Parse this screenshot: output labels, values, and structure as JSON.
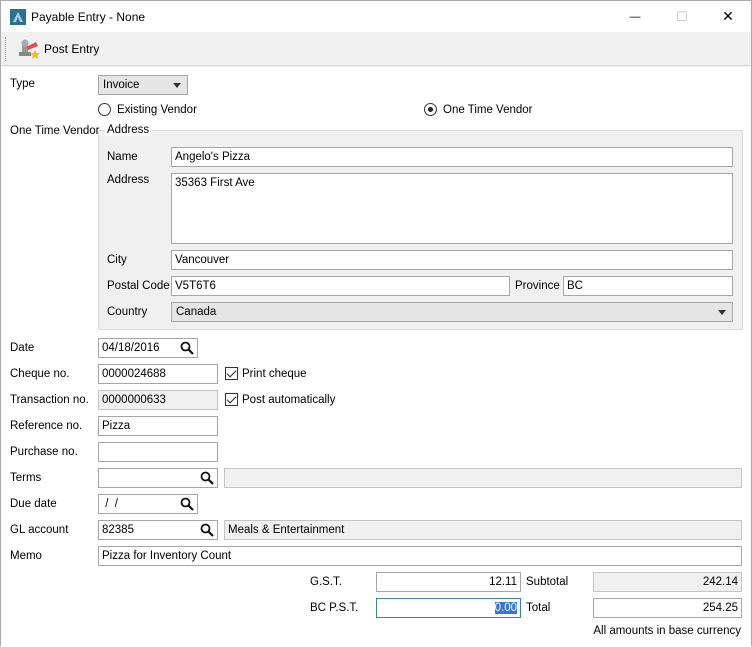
{
  "window": {
    "title": "Payable Entry -  None",
    "minimize_glyph": "—",
    "maximize_glyph": "☐",
    "close_glyph": "✕"
  },
  "toolbar": {
    "post_label": "Post Entry"
  },
  "type": {
    "label": "Type",
    "value": "Invoice"
  },
  "vendor_mode": {
    "existing_label": "Existing Vendor",
    "one_time_label": "One Time Vendor",
    "selected": "one_time"
  },
  "one_time": {
    "label": "One Time Vendor",
    "group_label": "Address",
    "name_label": "Name",
    "name": "Angelo's Pizza",
    "address_label": "Address",
    "address": "35363 First Ave",
    "city_label": "City",
    "city": "Vancouver",
    "postal_label": "Postal Code",
    "postal": "V5T6T6",
    "province_label": "Province",
    "province": "BC",
    "country_label": "Country",
    "country": "Canada"
  },
  "fields": {
    "date_label": "Date",
    "date": "04/18/2016",
    "cheque_label": "Cheque no.",
    "cheque": "0000024688",
    "print_cheque_label": "Print cheque",
    "transaction_label": "Transaction no.",
    "transaction": "0000000633",
    "post_auto_label": "Post automatically",
    "reference_label": "Reference no.",
    "reference": "Pizza",
    "purchase_label": "Purchase no.",
    "purchase": "",
    "terms_label": "Terms",
    "terms": "",
    "terms_desc": "",
    "due_label": "Due date",
    "due": " /  /",
    "gl_label": "GL account",
    "gl": "82385",
    "gl_desc": "Meals & Entertainment",
    "memo_label": "Memo",
    "memo": "Pizza for Inventory Count"
  },
  "totals": {
    "gst_label": "G.S.T.",
    "gst": "12.11",
    "pst_label": "BC P.S.T.",
    "pst": "0.00",
    "subtotal_label": "Subtotal",
    "subtotal": "242.14",
    "total_label": "Total",
    "total": "254.25",
    "note": "All amounts in base currency"
  },
  "icons": {
    "app": "spire-app-icon",
    "post": "stamp-icon",
    "search": "magnifier-icon",
    "dropdown": "chevron-down-icon"
  }
}
